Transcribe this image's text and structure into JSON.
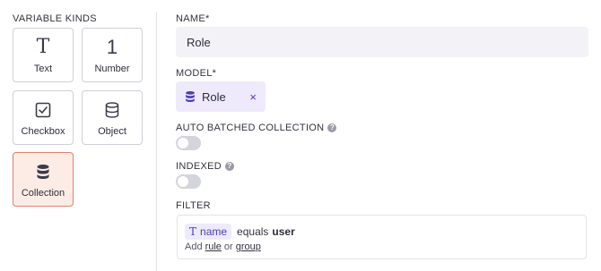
{
  "sidebar": {
    "title": "VARIABLE KINDS",
    "kinds": [
      {
        "label": "Text",
        "glyph": "T",
        "icon": "text-icon"
      },
      {
        "label": "Number",
        "glyph": "1",
        "icon": "number-icon"
      },
      {
        "label": "Checkbox",
        "icon": "checkbox-icon"
      },
      {
        "label": "Object",
        "icon": "database-icon"
      },
      {
        "label": "Collection",
        "icon": "database-icon",
        "selected": true
      }
    ]
  },
  "form": {
    "name_label": "NAME*",
    "name_value": "Role",
    "model_label": "MODEL*",
    "model_value": "Role",
    "model_remove": "×",
    "auto_batched_label": "AUTO BATCHED COLLECTION",
    "auto_batched_on": false,
    "indexed_label": "INDEXED",
    "indexed_on": false,
    "help_glyph": "?",
    "filter_label": "FILTER",
    "filter": {
      "field_glyph": "T",
      "field": "name",
      "operator": "equals",
      "value": "user",
      "add_prefix": "Add",
      "add_rule": "rule",
      "add_or": "or",
      "add_group": "group"
    }
  },
  "colors": {
    "selected_tile_bg": "#fdece6",
    "selected_tile_border": "#e0806a",
    "chip_bg": "#eeeafc",
    "accent": "#4a3fb0"
  }
}
